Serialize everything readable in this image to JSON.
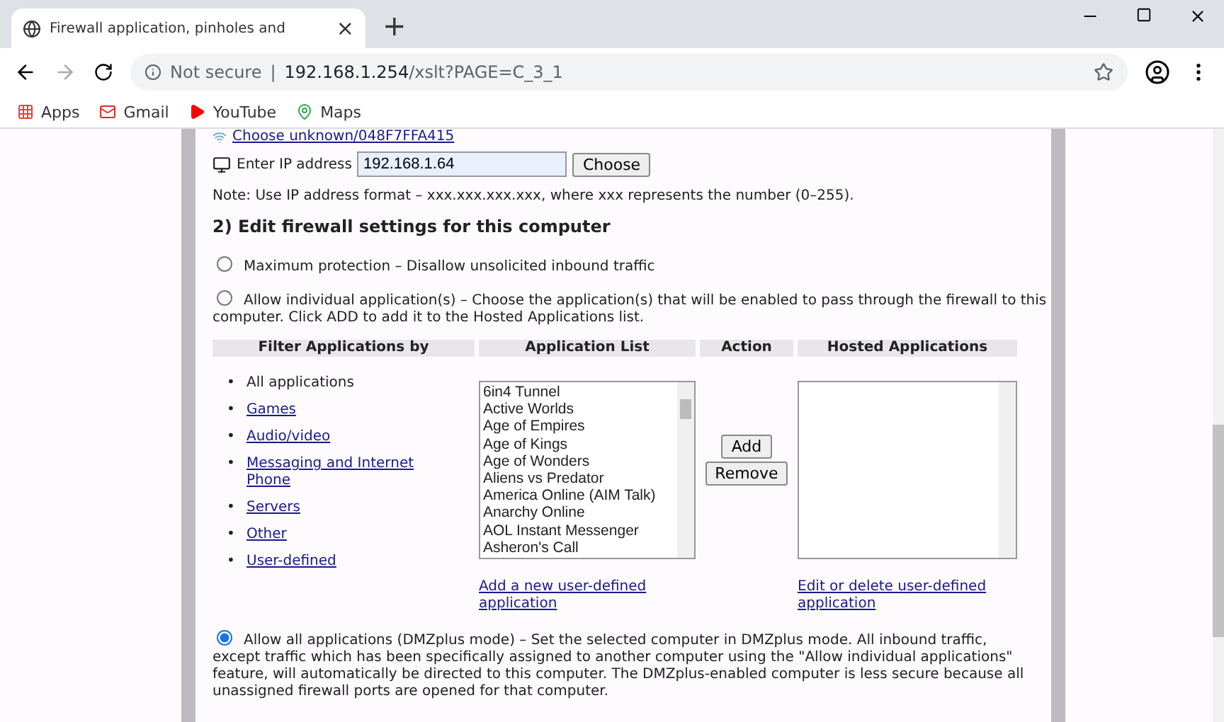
{
  "browser": {
    "tab_title": "Firewall application, pinholes and",
    "tab_close": "×",
    "new_tab": "+",
    "security": "Not secure",
    "separator": "|",
    "url_host": "192.168.1.254",
    "url_path": "/xslt?PAGE=C_3_1",
    "bookmarks": [
      {
        "label": "Apps",
        "kind": "apps"
      },
      {
        "label": "Gmail",
        "kind": "mail"
      },
      {
        "label": "YouTube",
        "kind": "video"
      },
      {
        "label": "Maps",
        "kind": "maps"
      }
    ]
  },
  "page": {
    "device_link": "Choose unknown/048F7FFA415",
    "ip_label": "Enter IP address",
    "ip_value": "192.168.1.64",
    "choose_button": "Choose",
    "note": "Note: Use IP address format – xxx.xxx.xxx.xxx, where xxx represents the number (0–255).",
    "heading": "2) Edit firewall settings for this computer",
    "options": [
      {
        "text": "Maximum protection – Disallow unsolicited inbound traffic",
        "selected": false
      },
      {
        "text": "Allow individual application(s) – Choose the application(s) that will be enabled to pass through the firewall to this computer. Click ADD to add it to the Hosted Applications list.",
        "selected": false
      }
    ],
    "columns": [
      "Filter Applications by",
      "Application List",
      "Action",
      "Hosted Applications"
    ],
    "bullet": "•",
    "filters": [
      {
        "label": "All applications",
        "link": false
      },
      {
        "label": "Games",
        "link": true
      },
      {
        "label": "Audio/video",
        "link": true
      },
      {
        "label": "Messaging and Internet Phone",
        "link": true
      },
      {
        "label": "Servers",
        "link": true
      },
      {
        "label": "Other",
        "link": true
      },
      {
        "label": "User-defined",
        "link": true
      }
    ],
    "applications": [
      "6in4 Tunnel",
      "Active Worlds",
      "Age of Empires",
      "Age of Kings",
      "Age of Wonders",
      "Aliens vs Predator",
      "America Online (AIM Talk)",
      "Anarchy Online",
      "AOL Instant Messenger",
      "Asheron's Call"
    ],
    "actions": [
      "Add",
      "Remove"
    ],
    "add_link": "Add a new user-defined application",
    "edit_link": "Edit or delete user-defined application",
    "dmz_option": {
      "text": "Allow all applications (DMZplus mode) – Set the selected computer in DMZplus mode. All inbound traffic, except traffic which has been specifically assigned to another computer using the \"Allow individual applications\" feature, will automatically be directed to this computer. The DMZplus-enabled computer is less secure because all unassigned firewall ports are opened for that computer.",
      "selected": true
    }
  }
}
